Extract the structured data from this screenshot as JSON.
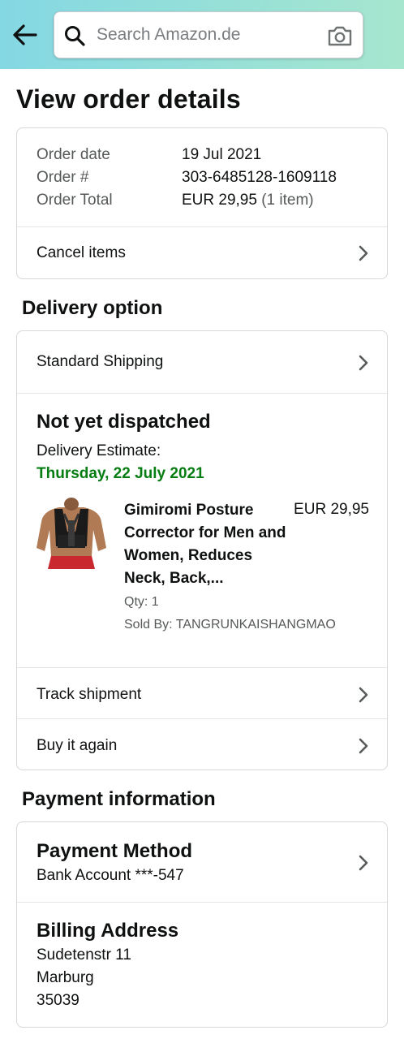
{
  "header": {
    "back_icon": "arrow-left-icon",
    "search_placeholder": "Search Amazon.de",
    "search_icon": "search-icon",
    "camera_icon": "camera-icon",
    "gradient_colors": [
      "#84d8e3",
      "#a6e6ce"
    ]
  },
  "page_title": "View order details",
  "order_summary": {
    "order_date_label": "Order date",
    "order_date_value": "19 Jul 2021",
    "order_number_label": "Order #",
    "order_number_value": "303-6485128-1609118",
    "order_total_label": "Order Total",
    "order_total_value": "EUR 29,95",
    "order_total_items": "(1 item)",
    "cancel_label": "Cancel items"
  },
  "delivery": {
    "section_title": "Delivery option",
    "shipping_method": "Standard Shipping",
    "status": "Not yet dispatched",
    "estimate_label": "Delivery Estimate:",
    "estimate_date": "Thursday, 22 July 2021",
    "estimate_color": "#067d12",
    "product": {
      "title": "Gimiromi Posture Corrector for Men and Women, Reduces Neck, Back,...",
      "price": "EUR 29,95",
      "qty": "Qty: 1",
      "seller": "Sold By: TANGRUNKAISHANGMAO"
    },
    "track_label": "Track shipment",
    "buy_again_label": "Buy it again"
  },
  "payment": {
    "section_title": "Payment information",
    "method_title": "Payment Method",
    "method_value": "Bank Account ***-547",
    "billing_title": "Billing Address",
    "billing_line1": "Sudetenstr 11",
    "billing_line2": "Marburg",
    "billing_line3": "35039"
  }
}
